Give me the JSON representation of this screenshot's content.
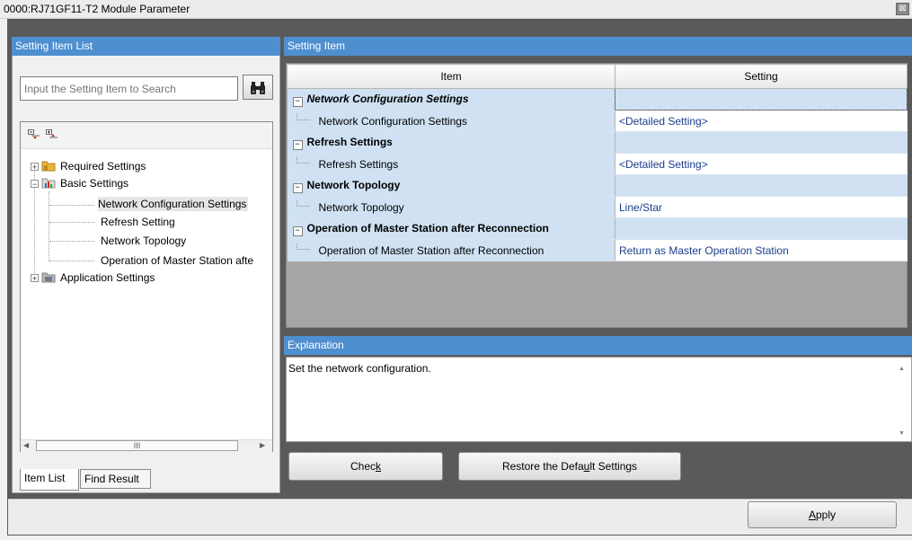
{
  "window": {
    "title": "0000:RJ71GF11-T2 Module Parameter",
    "close_glyph": "⊠"
  },
  "left_panel": {
    "header": "Setting Item List",
    "search_placeholder": "Input the Setting Item to Search",
    "tree": {
      "required": "Required Settings",
      "basic": "Basic Settings",
      "children": [
        "Network Configuration Settings",
        "Refresh Setting",
        "Network Topology",
        "Operation of Master Station afte"
      ],
      "application": "Application Settings"
    },
    "scroll_thumb_glyph": "III",
    "tabs": [
      "Item List",
      "Find Result"
    ]
  },
  "right_panel": {
    "header": "Setting Item",
    "columns": {
      "item": "Item",
      "setting": "Setting"
    },
    "groups": [
      {
        "label": "Network Configuration Settings",
        "italic": true,
        "child": "Network Configuration Settings",
        "value": "<Detailed Setting>"
      },
      {
        "label": "Refresh Settings",
        "italic": false,
        "child": "Refresh Settings",
        "value": "<Detailed Setting>"
      },
      {
        "label": "Network Topology",
        "italic": false,
        "child": "Network Topology",
        "value": "Line/Star"
      },
      {
        "label": "Operation of Master Station after Reconnection",
        "italic": false,
        "child": "Operation of Master Station after Reconnection",
        "value": "Return as Master Operation Station"
      }
    ],
    "explanation": {
      "header": "Explanation",
      "text": "Set the network configuration."
    },
    "buttons": {
      "check_pre": "Chec",
      "check_key": "k",
      "restore_pre": "Restore the Defa",
      "restore_key": "u",
      "restore_post": "lt Settings",
      "apply_key": "A",
      "apply_post": "pply"
    }
  },
  "colors": {
    "header_blue": "#4e8fd0",
    "row_blue": "#cfe1f3",
    "value_text": "#1a3c8c"
  }
}
